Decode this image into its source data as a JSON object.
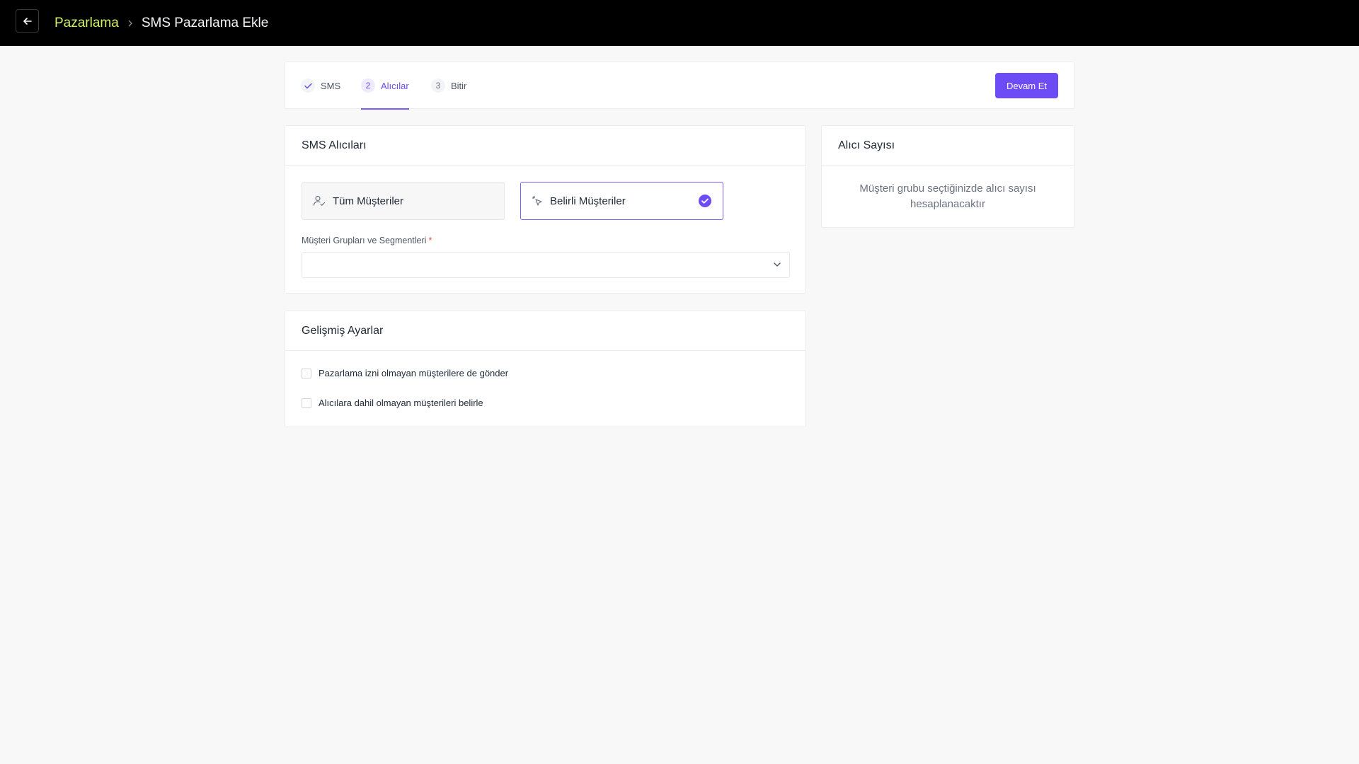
{
  "header": {
    "breadcrumb_parent": "Pazarlama",
    "breadcrumb_current": "SMS Pazarlama Ekle"
  },
  "stepper": {
    "steps": [
      {
        "badge": "✓",
        "label": "SMS",
        "state": "done"
      },
      {
        "badge": "2",
        "label": "Alıcılar",
        "state": "active"
      },
      {
        "badge": "3",
        "label": "Bitir",
        "state": "pending"
      }
    ],
    "continue_label": "Devam Et"
  },
  "recipients": {
    "title": "SMS Alıcıları",
    "options": [
      {
        "label": "Tüm Müşteriler",
        "selected": false
      },
      {
        "label": "Belirli Müşteriler",
        "selected": true
      }
    ],
    "group_label": "Müşteri Grupları ve Segmentleri",
    "group_required_mark": "*",
    "group_value": ""
  },
  "advanced": {
    "title": "Gelişmiş Ayarlar",
    "checkboxes": [
      {
        "label": "Pazarlama izni olmayan müşterilere de gönder",
        "checked": false
      },
      {
        "label": "Alıcılara dahil olmayan müşterileri belirle",
        "checked": false
      }
    ]
  },
  "count": {
    "title": "Alıcı Sayısı",
    "message": "Müşteri grubu seçtiğinizde alıcı sayısı hesaplanacaktır"
  },
  "colors": {
    "accent": "#6d4cf5",
    "breadcrumb_link": "#d4f26a",
    "topbar": "#000000"
  }
}
